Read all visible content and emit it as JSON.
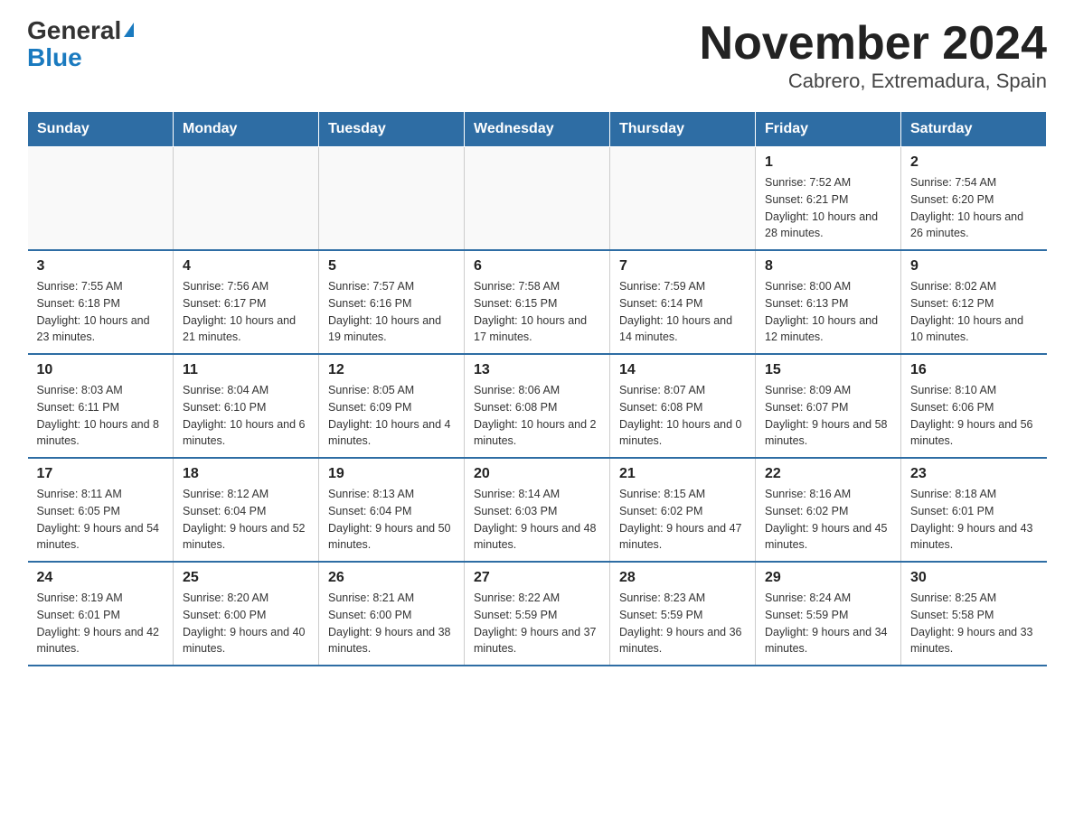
{
  "logo": {
    "general": "General",
    "blue": "Blue"
  },
  "title": "November 2024",
  "subtitle": "Cabrero, Extremadura, Spain",
  "weekdays": [
    "Sunday",
    "Monday",
    "Tuesday",
    "Wednesday",
    "Thursday",
    "Friday",
    "Saturday"
  ],
  "weeks": [
    [
      {
        "day": "",
        "info": ""
      },
      {
        "day": "",
        "info": ""
      },
      {
        "day": "",
        "info": ""
      },
      {
        "day": "",
        "info": ""
      },
      {
        "day": "",
        "info": ""
      },
      {
        "day": "1",
        "info": "Sunrise: 7:52 AM\nSunset: 6:21 PM\nDaylight: 10 hours and 28 minutes."
      },
      {
        "day": "2",
        "info": "Sunrise: 7:54 AM\nSunset: 6:20 PM\nDaylight: 10 hours and 26 minutes."
      }
    ],
    [
      {
        "day": "3",
        "info": "Sunrise: 7:55 AM\nSunset: 6:18 PM\nDaylight: 10 hours and 23 minutes."
      },
      {
        "day": "4",
        "info": "Sunrise: 7:56 AM\nSunset: 6:17 PM\nDaylight: 10 hours and 21 minutes."
      },
      {
        "day": "5",
        "info": "Sunrise: 7:57 AM\nSunset: 6:16 PM\nDaylight: 10 hours and 19 minutes."
      },
      {
        "day": "6",
        "info": "Sunrise: 7:58 AM\nSunset: 6:15 PM\nDaylight: 10 hours and 17 minutes."
      },
      {
        "day": "7",
        "info": "Sunrise: 7:59 AM\nSunset: 6:14 PM\nDaylight: 10 hours and 14 minutes."
      },
      {
        "day": "8",
        "info": "Sunrise: 8:00 AM\nSunset: 6:13 PM\nDaylight: 10 hours and 12 minutes."
      },
      {
        "day": "9",
        "info": "Sunrise: 8:02 AM\nSunset: 6:12 PM\nDaylight: 10 hours and 10 minutes."
      }
    ],
    [
      {
        "day": "10",
        "info": "Sunrise: 8:03 AM\nSunset: 6:11 PM\nDaylight: 10 hours and 8 minutes."
      },
      {
        "day": "11",
        "info": "Sunrise: 8:04 AM\nSunset: 6:10 PM\nDaylight: 10 hours and 6 minutes."
      },
      {
        "day": "12",
        "info": "Sunrise: 8:05 AM\nSunset: 6:09 PM\nDaylight: 10 hours and 4 minutes."
      },
      {
        "day": "13",
        "info": "Sunrise: 8:06 AM\nSunset: 6:08 PM\nDaylight: 10 hours and 2 minutes."
      },
      {
        "day": "14",
        "info": "Sunrise: 8:07 AM\nSunset: 6:08 PM\nDaylight: 10 hours and 0 minutes."
      },
      {
        "day": "15",
        "info": "Sunrise: 8:09 AM\nSunset: 6:07 PM\nDaylight: 9 hours and 58 minutes."
      },
      {
        "day": "16",
        "info": "Sunrise: 8:10 AM\nSunset: 6:06 PM\nDaylight: 9 hours and 56 minutes."
      }
    ],
    [
      {
        "day": "17",
        "info": "Sunrise: 8:11 AM\nSunset: 6:05 PM\nDaylight: 9 hours and 54 minutes."
      },
      {
        "day": "18",
        "info": "Sunrise: 8:12 AM\nSunset: 6:04 PM\nDaylight: 9 hours and 52 minutes."
      },
      {
        "day": "19",
        "info": "Sunrise: 8:13 AM\nSunset: 6:04 PM\nDaylight: 9 hours and 50 minutes."
      },
      {
        "day": "20",
        "info": "Sunrise: 8:14 AM\nSunset: 6:03 PM\nDaylight: 9 hours and 48 minutes."
      },
      {
        "day": "21",
        "info": "Sunrise: 8:15 AM\nSunset: 6:02 PM\nDaylight: 9 hours and 47 minutes."
      },
      {
        "day": "22",
        "info": "Sunrise: 8:16 AM\nSunset: 6:02 PM\nDaylight: 9 hours and 45 minutes."
      },
      {
        "day": "23",
        "info": "Sunrise: 8:18 AM\nSunset: 6:01 PM\nDaylight: 9 hours and 43 minutes."
      }
    ],
    [
      {
        "day": "24",
        "info": "Sunrise: 8:19 AM\nSunset: 6:01 PM\nDaylight: 9 hours and 42 minutes."
      },
      {
        "day": "25",
        "info": "Sunrise: 8:20 AM\nSunset: 6:00 PM\nDaylight: 9 hours and 40 minutes."
      },
      {
        "day": "26",
        "info": "Sunrise: 8:21 AM\nSunset: 6:00 PM\nDaylight: 9 hours and 38 minutes."
      },
      {
        "day": "27",
        "info": "Sunrise: 8:22 AM\nSunset: 5:59 PM\nDaylight: 9 hours and 37 minutes."
      },
      {
        "day": "28",
        "info": "Sunrise: 8:23 AM\nSunset: 5:59 PM\nDaylight: 9 hours and 36 minutes."
      },
      {
        "day": "29",
        "info": "Sunrise: 8:24 AM\nSunset: 5:59 PM\nDaylight: 9 hours and 34 minutes."
      },
      {
        "day": "30",
        "info": "Sunrise: 8:25 AM\nSunset: 5:58 PM\nDaylight: 9 hours and 33 minutes."
      }
    ]
  ]
}
